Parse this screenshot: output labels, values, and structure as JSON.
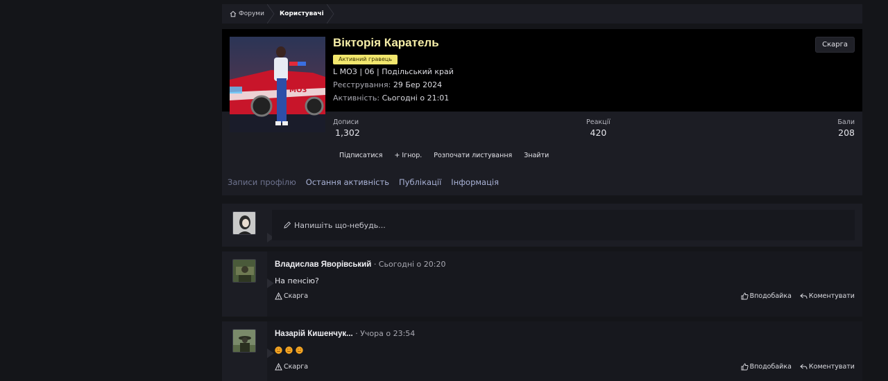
{
  "breadcrumb": {
    "forums": "Форуми",
    "users": "Користувачі"
  },
  "profile": {
    "name": "Вікторія Каратель",
    "badge": "Активний гравець",
    "title_line": "L МОЗ | 06 | Подільський край",
    "registered_label": "Реєстрування:",
    "registered_value": "29 Бер 2024",
    "activity_label": "Активність:",
    "activity_value": "Сьогодні о 21:01",
    "report": "Скарга",
    "stats": [
      {
        "label": "Дописи",
        "value": "1,302"
      },
      {
        "label": "Реакції",
        "value": "420"
      },
      {
        "label": "Бали",
        "value": "208"
      }
    ],
    "actions": [
      "Підписатися",
      "+ Ігнор.",
      "Розпочати листування",
      "Знайти"
    ],
    "tabs": [
      "Записи профілю",
      "Остання активність",
      "Публікації",
      "Інформація"
    ]
  },
  "status": {
    "placeholder": "Напишіть що-небудь..."
  },
  "posts": [
    {
      "author": "Владислав Яворівський",
      "time": "· Сьогодні о 20:20",
      "text": "На пенсію?",
      "report": "Скарга",
      "like": "Вподобайка",
      "comment": "Коментувати"
    },
    {
      "author": "Назарій Кишенчук...",
      "time": "· Учора о 23:54",
      "text": "",
      "emoji_count": 3,
      "report": "Скарга",
      "like": "Вподобайка",
      "comment": "Коментувати"
    }
  ],
  "colors": {
    "page_bg": "#141519",
    "panel_bg": "#1c1d24",
    "name": "#f6eea8",
    "badge": "#f2e76e",
    "tab_link": "#a9b2d6"
  }
}
